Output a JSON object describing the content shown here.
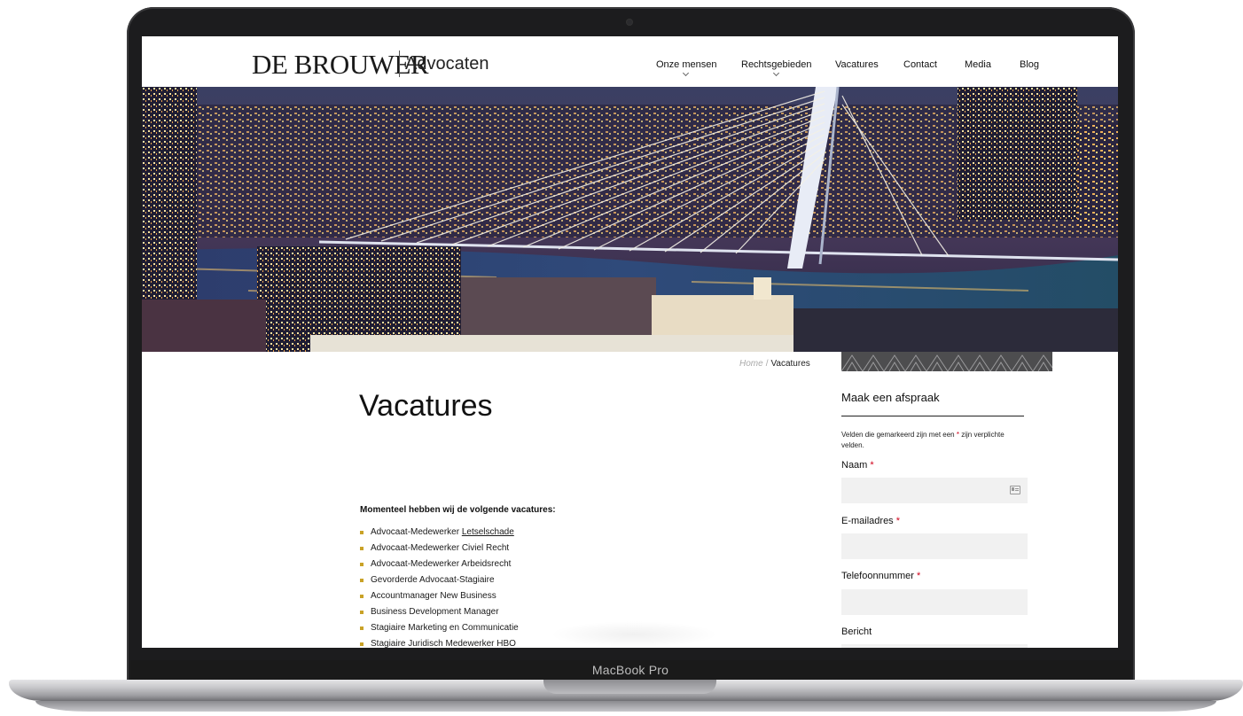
{
  "device": {
    "label": "MacBook Pro"
  },
  "header": {
    "logo_main": "DE BROUWER",
    "logo_sub": "Advocaten",
    "nav": [
      {
        "label": "Onze mensen",
        "has_dropdown": true
      },
      {
        "label": "Rechtsgebieden",
        "has_dropdown": true
      },
      {
        "label": "Vacatures",
        "has_dropdown": false
      },
      {
        "label": "Contact",
        "has_dropdown": false
      },
      {
        "label": "Media",
        "has_dropdown": false
      },
      {
        "label": "Blog",
        "has_dropdown": false
      }
    ]
  },
  "breadcrumb": {
    "home": "Home",
    "separator": "/",
    "current": "Vacatures"
  },
  "main": {
    "title": "Vacatures",
    "intro": "Momenteel hebben wij de volgende vacatures:",
    "vacancies": [
      {
        "prefix": "Advocaat-Medewerker",
        "link": "Letselschade"
      },
      {
        "label": "Advocaat-Medewerker Civiel Recht"
      },
      {
        "label": "Advocaat-Medewerker Arbeidsrecht"
      },
      {
        "label": "Gevorderde Advocaat-Stagiaire"
      },
      {
        "label": "Accountmanager New Business"
      },
      {
        "label": "Business Development Manager"
      },
      {
        "label": "Stagiaire Marketing en Communicatie"
      },
      {
        "label": "Stagiaire Juridisch Medewerker HBO"
      }
    ]
  },
  "form": {
    "title": "Maak een afspraak",
    "note_before": "Velden die gemarkeerd zijn met een",
    "note_star": "*",
    "note_after": "zijn verplichte velden.",
    "required_marker": "*",
    "fields": [
      {
        "label": "Naam",
        "required": true,
        "value": ""
      },
      {
        "label": "E-mailadres",
        "required": true,
        "value": ""
      },
      {
        "label": "Telefoonnummer",
        "required": true,
        "value": ""
      },
      {
        "label": "Bericht",
        "required": false,
        "value": ""
      }
    ]
  },
  "colors": {
    "bullet": "#c9a227",
    "required": "#d0021b",
    "input_bg": "#f1f1f1"
  }
}
